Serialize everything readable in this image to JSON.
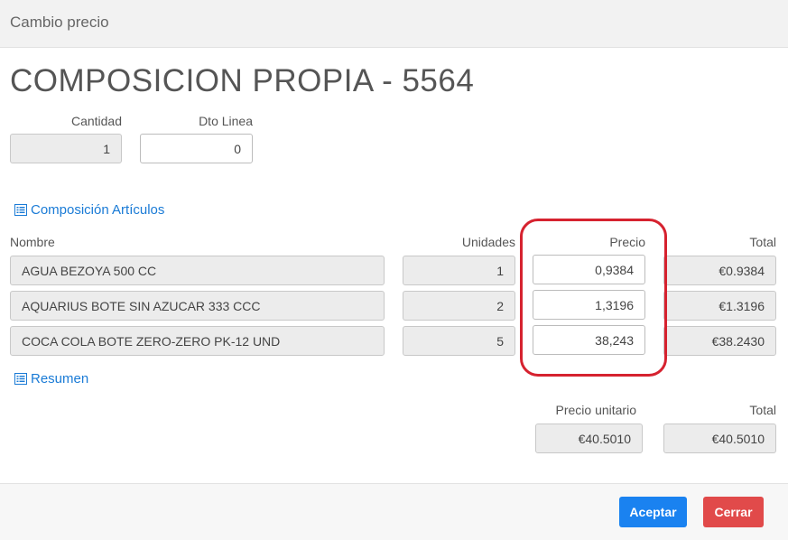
{
  "dialog": {
    "title": "Cambio precio"
  },
  "product": {
    "title": "COMPOSICION PROPIA - 5564"
  },
  "form": {
    "cantidad_label": "Cantidad",
    "cantidad_value": "1",
    "dto_label": "Dto Linea",
    "dto_value": "0"
  },
  "composition": {
    "section_label": "Composición Artículos",
    "columns": {
      "nombre": "Nombre",
      "unidades": "Unidades",
      "precio": "Precio",
      "total": "Total"
    },
    "rows": [
      {
        "nombre": "AGUA BEZOYA 500 CC",
        "unidades": "1",
        "precio": "0,9384",
        "total": "€0.9384"
      },
      {
        "nombre": "AQUARIUS BOTE SIN AZUCAR 333 CCC",
        "unidades": "2",
        "precio": "1,3196",
        "total": "€1.3196"
      },
      {
        "nombre": "COCA COLA BOTE ZERO-ZERO PK-12 UND",
        "unidades": "5",
        "precio": "38,243",
        "total": "€38.2430"
      }
    ]
  },
  "summary": {
    "section_label": "Resumen",
    "precio_unitario_label": "Precio unitario",
    "precio_unitario_value": "€40.5010",
    "total_label": "Total",
    "total_value": "€40.5010"
  },
  "buttons": {
    "accept": "Aceptar",
    "close": "Cerrar"
  },
  "colors": {
    "accent": "#1a82f0",
    "danger": "#e14a4a",
    "highlight": "#d6222f",
    "link": "#1a7bd6"
  }
}
